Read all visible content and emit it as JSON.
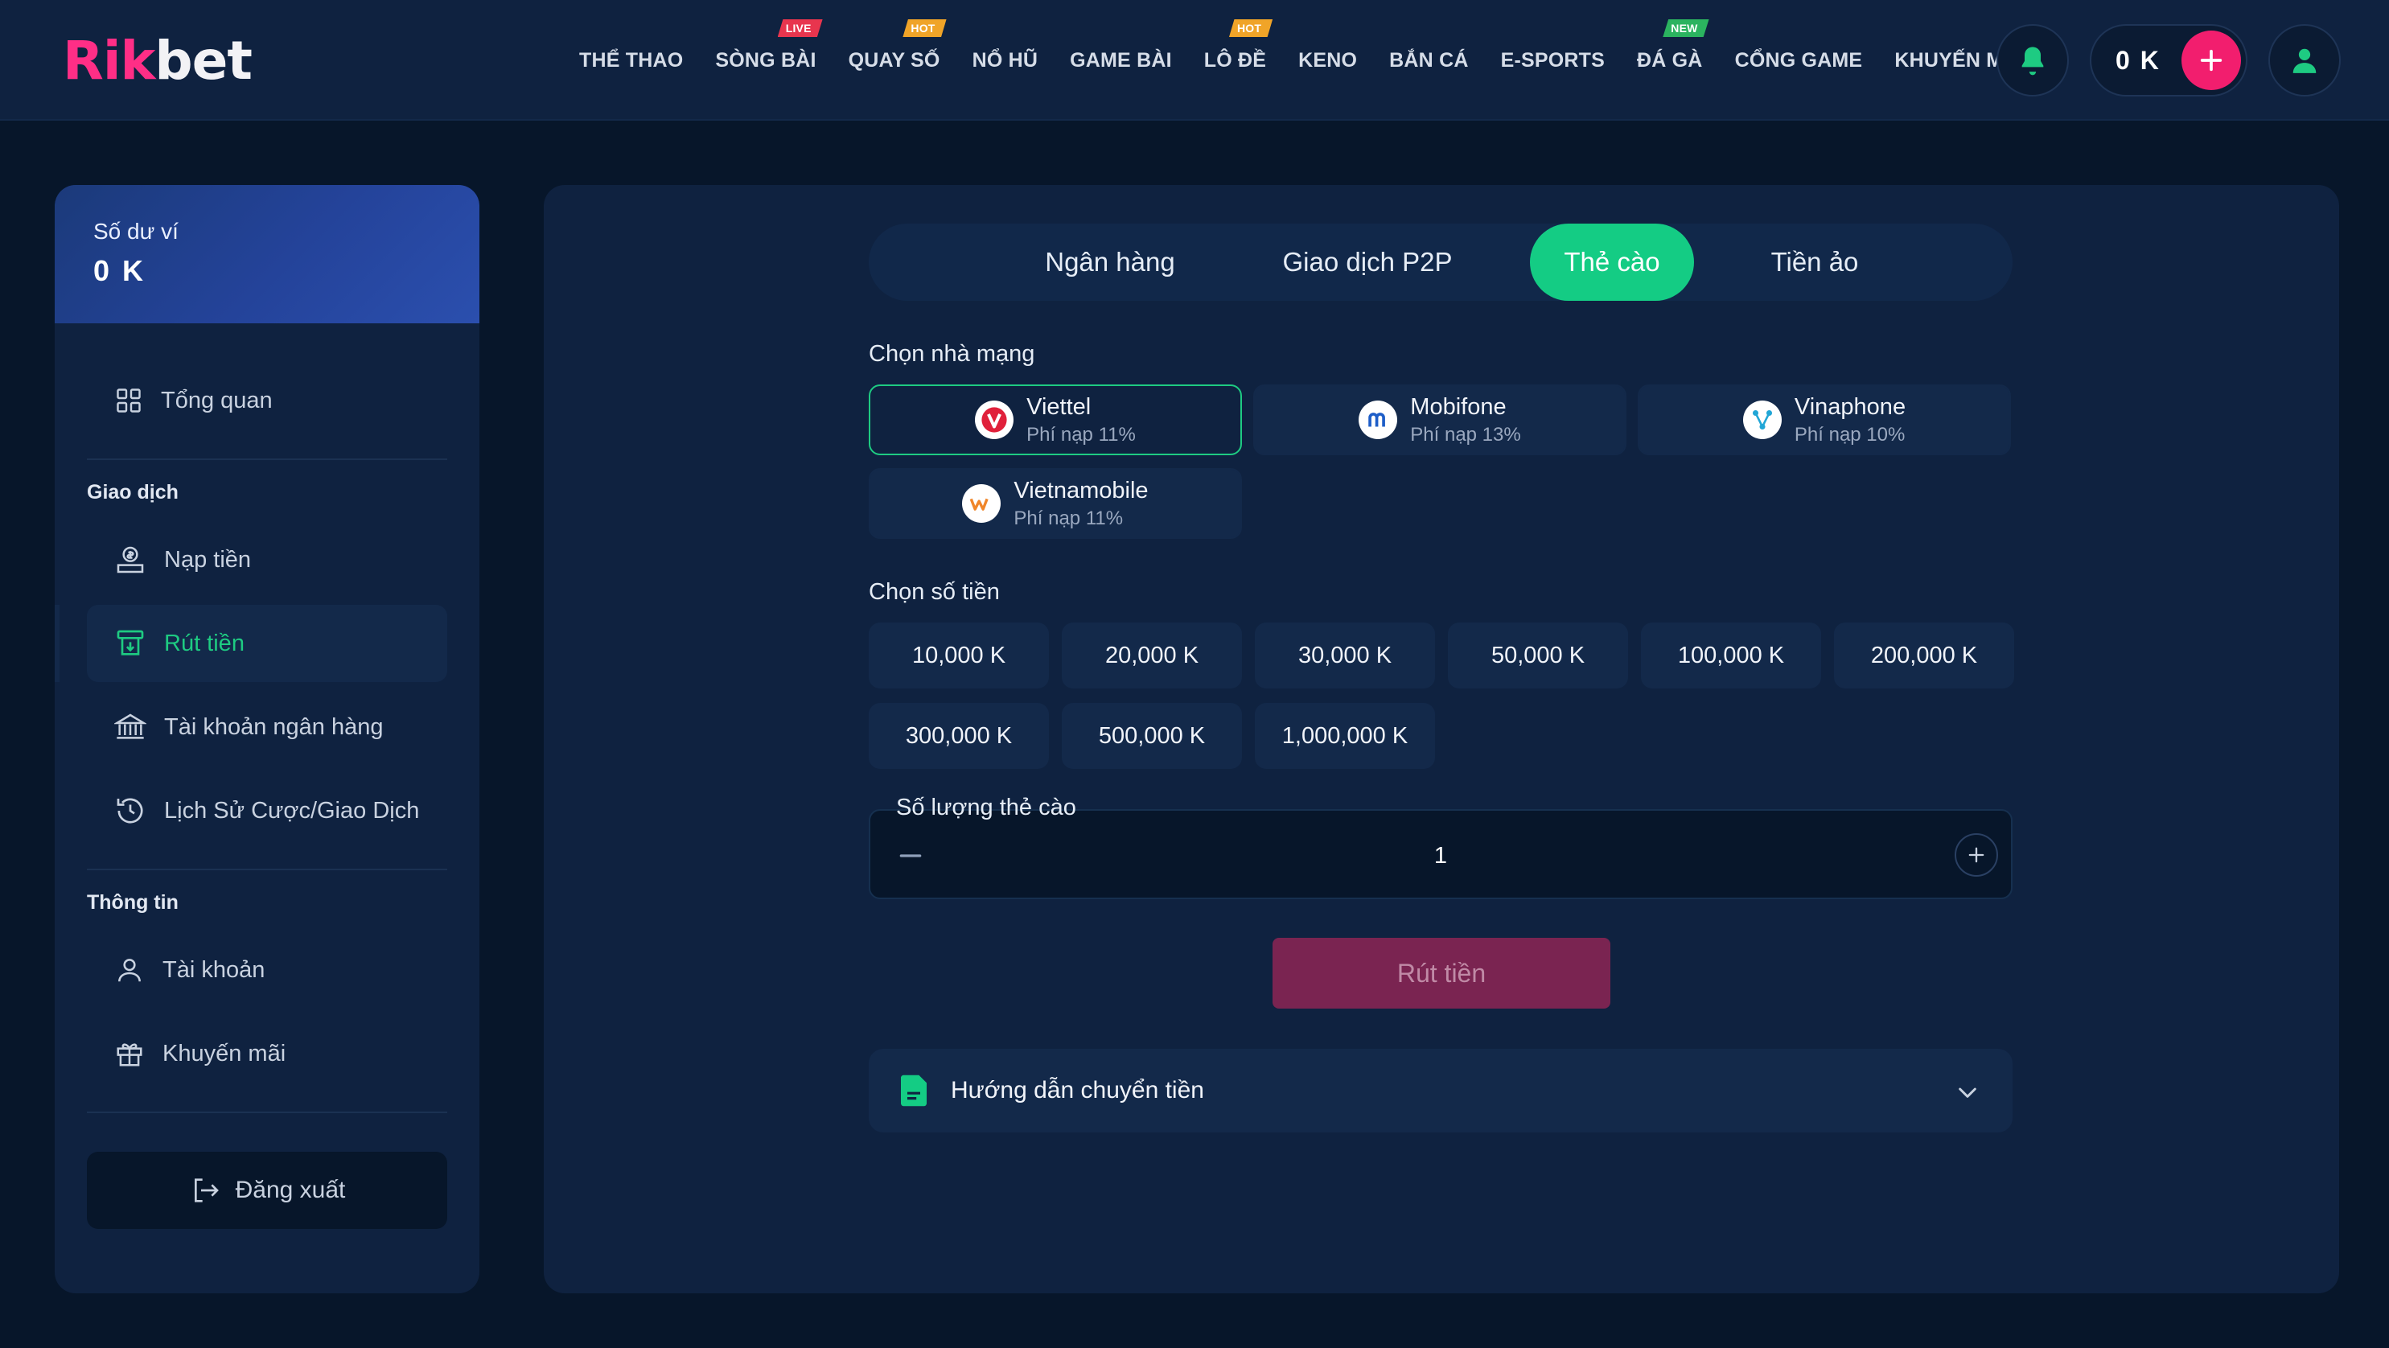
{
  "header": {
    "logo_part1": "Rik",
    "logo_part2": "bet",
    "nav": [
      {
        "label": "THỂ THAO",
        "badge": ""
      },
      {
        "label": "SÒNG BÀI",
        "badge": "LIVE"
      },
      {
        "label": "QUAY SỐ",
        "badge": "HOT"
      },
      {
        "label": "NỔ HŨ",
        "badge": ""
      },
      {
        "label": "GAME BÀI",
        "badge": ""
      },
      {
        "label": "LÔ ĐỀ",
        "badge": "HOT"
      },
      {
        "label": "KENO",
        "badge": ""
      },
      {
        "label": "BẮN CÁ",
        "badge": ""
      },
      {
        "label": "E-SPORTS",
        "badge": ""
      },
      {
        "label": "ĐÁ GÀ",
        "badge": "NEW"
      },
      {
        "label": "CỔNG GAME",
        "badge": ""
      },
      {
        "label": "KHUYẾN MÃI",
        "badge": ""
      }
    ],
    "balance": "0 K",
    "icons": {
      "notification": "bell-icon",
      "deposit": "plus-icon",
      "profile": "user-icon"
    }
  },
  "sidebar": {
    "wallet_label": "Số dư ví",
    "wallet_value": "0 K",
    "overview": "Tổng quan",
    "section_transactions": "Giao dịch",
    "deposit": "Nạp tiền",
    "withdraw": "Rút tiền",
    "bank_account": "Tài khoản ngân hàng",
    "history": "Lịch Sử Cược/Giao Dịch",
    "section_info": "Thông tin",
    "account": "Tài khoản",
    "promotions": "Khuyến mãi",
    "logout": "Đăng xuất"
  },
  "main": {
    "tabs": [
      "Ngân hàng",
      "Giao dịch P2P",
      "Thẻ cào",
      "Tiền ảo"
    ],
    "active_tab": "Thẻ cào",
    "carrier_label": "Chọn nhà mạng",
    "carriers": [
      {
        "name": "Viettel",
        "fee": "Phí nạp 11%",
        "selected": true
      },
      {
        "name": "Mobifone",
        "fee": "Phí nạp 13%",
        "selected": false
      },
      {
        "name": "Vinaphone",
        "fee": "Phí nạp 10%",
        "selected": false
      },
      {
        "name": "Vietnamobile",
        "fee": "Phí nạp 11%",
        "selected": false
      }
    ],
    "amount_label": "Chọn số tiền",
    "amounts": [
      "10,000 K",
      "20,000 K",
      "30,000 K",
      "50,000 K",
      "100,000 K",
      "200,000 K",
      "300,000 K",
      "500,000 K",
      "1,000,000 K"
    ],
    "quantity_label": "Số lượng thẻ cào",
    "quantity_value": "1",
    "submit": "Rút tiền",
    "guide": "Hướng dẫn chuyển tiền"
  },
  "colors": {
    "background": "#07162a",
    "panel": "#0f2240",
    "accent_green": "#14cc84",
    "brand_pink": "#ff2e86",
    "submit_disabled": "#7a2451"
  }
}
